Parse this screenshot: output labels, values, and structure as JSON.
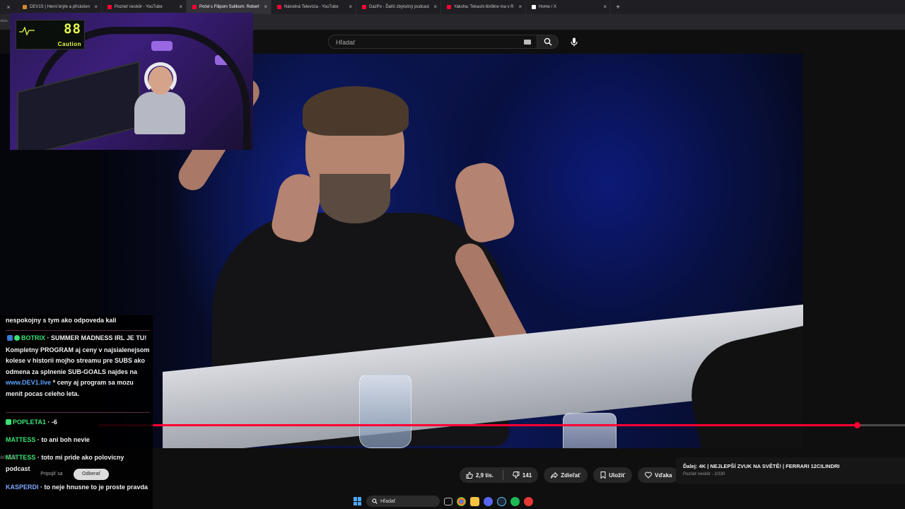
{
  "browser": {
    "tabs": [
      {
        "label": "DEV1S | Herní brýle a příslušen",
        "favicon_color": "#d98a2b",
        "active": false
      },
      {
        "label": "Pozrieť neskôr - YouTube",
        "favicon_color": "#ff0033",
        "active": false
      },
      {
        "label": "Poťel s Filipom Sulíkom: Robert",
        "favicon_color": "#ff0033",
        "active": true
      },
      {
        "label": "Národná Televízia - YouTube",
        "favicon_color": "#ff0033",
        "active": false
      },
      {
        "label": "DazPo - Ďalší zbytočný podcast",
        "favicon_color": "#ff0033",
        "active": false
      },
      {
        "label": "Yaksha: Tekashi 6ix9ine ma v R",
        "favicon_color": "#ff0033",
        "active": false
      },
      {
        "label": "Home / X",
        "favicon_color": "#ffffff",
        "active": false
      }
    ],
    "new_tab_glyph": "+",
    "close_glyph": "×",
    "address_hint": "dista"
  },
  "youtube": {
    "search_placeholder": "Hľadať",
    "icons": {
      "search": "search-icon",
      "mic": "mic-icon",
      "keyboard": "keyboard-icon"
    },
    "progress": 0.94,
    "accent_color": "#ff0033"
  },
  "overlay": {
    "gauge_value": "88",
    "gauge_label": "Caution"
  },
  "chat": {
    "messages": [
      {
        "user": "",
        "text": "nespokojny s tym ako odpoveda kali"
      },
      {
        "user": "BOTRIX",
        "user_color": "#3ae374",
        "text": "SUMMER MADNESS IRL JE TU! Kompletny PROGRAM aj ceny v najsialenejsom kolese v historii mojho streamu pre SUBS ako odmena za splnenie SUB-GOALS najdes na",
        "link": "www.DEV1.live",
        "after": "* ceny aj program sa mozu menit pocas celeho leta."
      },
      {
        "user": "POPLETA1",
        "user_color": "#3ae374",
        "text": "-6"
      },
      {
        "user": "MATTESS",
        "user_color": "#3ae374",
        "text": "to ani boh nevie"
      },
      {
        "user": "MATTESS",
        "user_color": "#3ae374",
        "text": "toto mi pride ako polovicny podcast"
      },
      {
        "user": "KASPERDI",
        "user_color": "#7fa7ff",
        "text": "to neje hnusne to je proste pravda"
      }
    ],
    "ghost_text": "an Sul",
    "join_label": "Pripojiť sa",
    "subscribe_label": "Odberať"
  },
  "actions": {
    "likes": "2,9 tis.",
    "dislikes": "141",
    "share": "Zdieľať",
    "save": "Uložiť",
    "thanks": "Vďaka",
    "more": "•••"
  },
  "up_next": {
    "prefix": "Ďalej:",
    "title": "4K | NEJLEPŠÍ ZVUK NA SVĚTĚ! | FERRARI 12CILINDRI",
    "playlist": "Pozrieť neskôr - 2/330"
  },
  "taskbar": {
    "search_label": "Hľadať"
  }
}
